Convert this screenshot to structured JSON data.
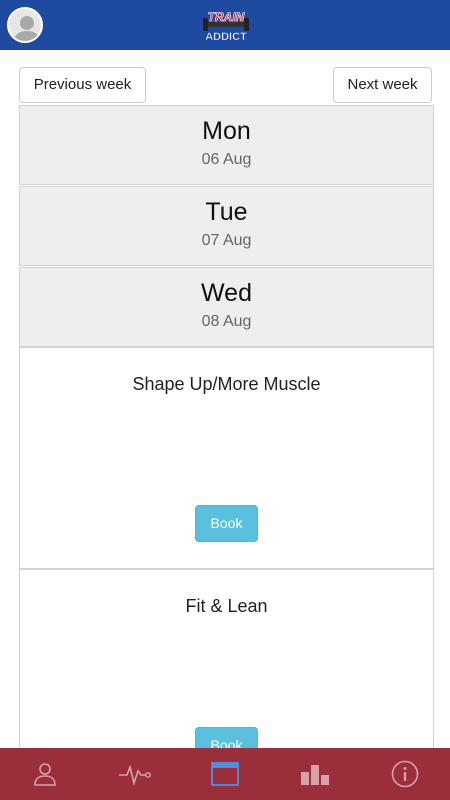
{
  "header": {
    "logo": {
      "line1": "TRAIN",
      "line2": "ADDICT"
    }
  },
  "week_nav": {
    "previous_label": "Previous week",
    "next_label": "Next week"
  },
  "days": [
    {
      "name": "Mon",
      "date": "06 Aug"
    },
    {
      "name": "Tue",
      "date": "07 Aug"
    },
    {
      "name": "Wed",
      "date": "08 Aug"
    }
  ],
  "classes": [
    {
      "title": "Shape Up/More Muscle",
      "button_label": "Book"
    },
    {
      "title": "Fit & Lean",
      "button_label": "Book"
    }
  ],
  "bottom_nav": {
    "items": [
      {
        "icon": "person-icon"
      },
      {
        "icon": "activity-icon"
      },
      {
        "icon": "calendar-icon",
        "active": true
      },
      {
        "icon": "bar-chart-icon"
      },
      {
        "icon": "info-icon"
      }
    ]
  },
  "colors": {
    "header_bg": "#1e4aa0",
    "bottom_nav_bg": "#9b2e3b",
    "book_button": "#5bc0de",
    "day_bg": "#eeeeee"
  }
}
